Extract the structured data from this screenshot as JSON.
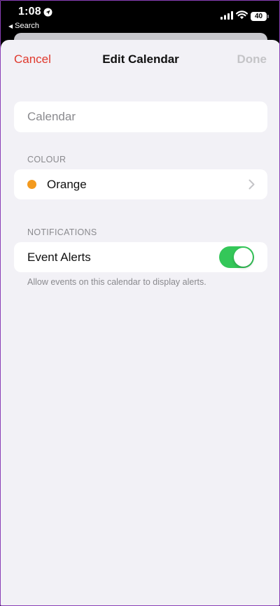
{
  "status_bar": {
    "time": "1:08",
    "back_app": "Search",
    "battery": "40",
    "icons": [
      "location-icon",
      "signal-icon",
      "wifi-icon",
      "battery-icon"
    ]
  },
  "nav": {
    "cancel": "Cancel",
    "title": "Edit Calendar",
    "done": "Done"
  },
  "calendar": {
    "placeholder": "Calendar",
    "value": ""
  },
  "colour": {
    "header": "COLOUR",
    "selected": "Orange",
    "swatch": "#f39a1e"
  },
  "notifications": {
    "header": "NOTIFICATIONS",
    "event_alerts_label": "Event Alerts",
    "event_alerts_on": true,
    "footer": "Allow events on this calendar to display alerts."
  },
  "colors": {
    "accent_red": "#e0392d",
    "toggle_on": "#34c759",
    "done_disabled": "#c4c4c7",
    "background": "#f2f1f6"
  }
}
